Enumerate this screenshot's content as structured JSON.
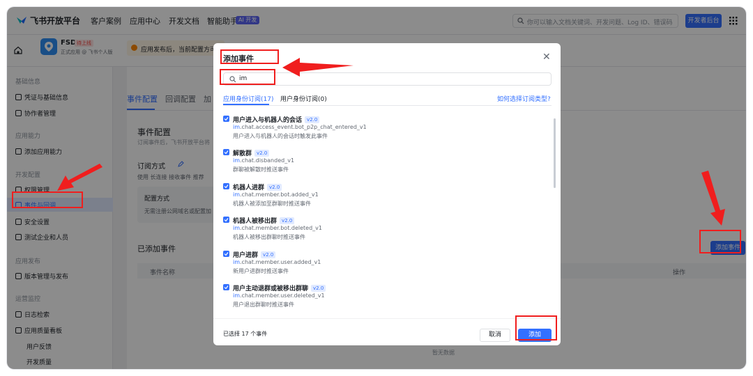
{
  "topnav": {
    "logo": "飞书开放平台",
    "items": [
      "客户案例",
      "应用中心",
      "开发文档",
      "智能助手"
    ],
    "ai_badge": "AI 开发",
    "search_placeholder": "你可以输入文档关键词、开发问题、Log ID、错误码",
    "dev_console": "开发者后台"
  },
  "app": {
    "name": "FSD",
    "status": "待上线",
    "subtitle": "正式应用 @ 飞书个人版",
    "notice": "应用发布后，当前配置方可"
  },
  "sidebar": {
    "groups": [
      {
        "label": "基础信息",
        "items": [
          "凭证与基础信息",
          "协作者管理"
        ]
      },
      {
        "label": "应用能力",
        "items": [
          "添加应用能力"
        ]
      },
      {
        "label": "开发配置",
        "items": [
          "权限管理",
          "事件与回调",
          "安全设置",
          "测试企业和人员"
        ]
      },
      {
        "label": "应用发布",
        "items": [
          "版本管理与发布"
        ]
      },
      {
        "label": "运营监控",
        "items": [
          "日志检索",
          "应用质量看板"
        ]
      }
    ],
    "subitems": [
      "用户反馈",
      "开发质量"
    ]
  },
  "main": {
    "tabs": [
      "事件配置",
      "回调配置",
      "加"
    ],
    "section_title": "事件配置",
    "section_desc": "订阅事件后，飞书开放平台将",
    "sub_title": "订阅方式",
    "sub_desc_prefix": "使用 长连接 接收事件",
    "sub_desc_badge": "推荐",
    "config_title": "配置方式",
    "config_desc": "无需注册公网域名或配置加",
    "added_title": "已添加事件",
    "add_button": "添加事件",
    "table_headers": [
      "事件名称",
      "操作"
    ],
    "empty": "暂无数据"
  },
  "modal": {
    "title": "添加事件",
    "search_value": "im",
    "tabs": [
      "应用身份订阅(17)",
      "用户身份订阅(0)"
    ],
    "help_link": "如何选择订阅类型?",
    "events": [
      {
        "name": "用户进入与机器人的会话",
        "version": "v2.0",
        "key_hl": "im",
        "key_rest": ".chat.access_event.bot_p2p_chat_entered_v1",
        "desc": "用户进入与机器人的会话时触发此事件"
      },
      {
        "name": "解散群",
        "version": "v2.0",
        "key_hl": "im",
        "key_rest": ".chat.disbanded_v1",
        "desc": "群聊被解散时推送事件"
      },
      {
        "name": "机器人进群",
        "version": "v2.0",
        "key_hl": "im",
        "key_rest": ".chat.member.bot.added_v1",
        "desc": "机器人被添加至群聊时推送事件"
      },
      {
        "name": "机器人被移出群",
        "version": "v2.0",
        "key_hl": "im",
        "key_rest": ".chat.member.bot.deleted_v1",
        "desc": "机器人被移出群聊时推送事件"
      },
      {
        "name": "用户进群",
        "version": "v2.0",
        "key_hl": "im",
        "key_rest": ".chat.member.user.added_v1",
        "desc": "新用户进群时推送事件"
      },
      {
        "name": "用户主动退群或被移出群聊",
        "version": "v2.0",
        "key_hl": "im",
        "key_rest": ".chat.member.user.deleted_v1",
        "desc": "用户退出群聊时推送事件"
      }
    ],
    "selected_count": "已选择 17 个事件",
    "cancel": "取消",
    "add": "添加"
  },
  "colors": {
    "accent": "#3370ff",
    "annotation": "#f01e1e"
  }
}
